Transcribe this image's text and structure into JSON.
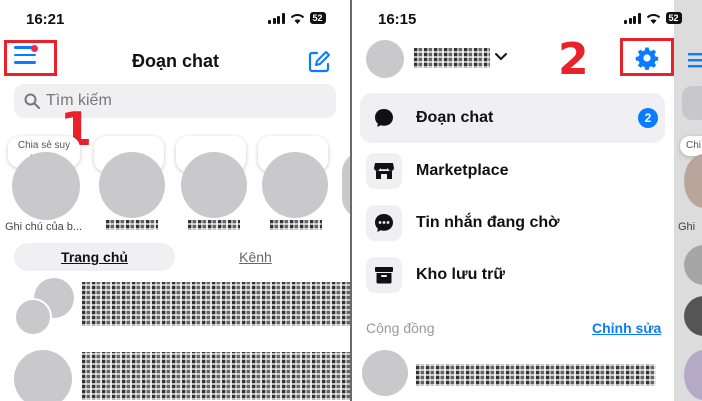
{
  "left": {
    "status_time": "16:21",
    "battery": "52",
    "title": "Đoạn chat",
    "search_placeholder": "Tìm kiếm",
    "step_number": "1",
    "story_note": "Chia sẻ suy nghĩ...",
    "story_label": "Ghi chú của b...",
    "tabs": [
      {
        "label": "Trang chủ",
        "active": true
      },
      {
        "label": "Kênh",
        "active": false
      }
    ]
  },
  "right": {
    "status_time": "16:15",
    "battery": "52",
    "step_number": "2",
    "menu": [
      {
        "label": "Đoạn chat",
        "icon": "chat-bubble-icon",
        "badge": "2",
        "active": true
      },
      {
        "label": "Marketplace",
        "icon": "store-icon"
      },
      {
        "label": "Tin nhắn đang chờ",
        "icon": "pending-message-icon"
      },
      {
        "label": "Kho lưu trữ",
        "icon": "archive-box-icon"
      }
    ],
    "section": {
      "title": "Cộng đồng",
      "edit_link": "Chỉnh sửa"
    },
    "peek": {
      "story_note": "Chi",
      "story_label": "Ghi"
    }
  },
  "colors": {
    "accent": "#0a7cff",
    "highlight_red": "#e8212a",
    "notification_dot": "#f02849"
  }
}
